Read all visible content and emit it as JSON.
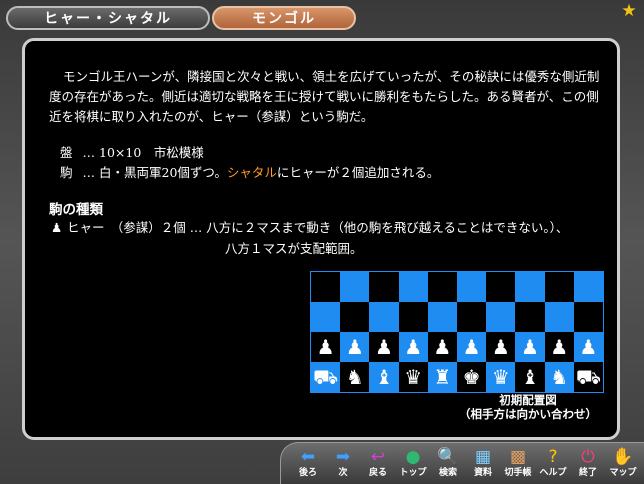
{
  "tabs": {
    "active": "ヒャー・シャタル",
    "inactive": "モンゴル"
  },
  "intro": "モンゴル王ハーンが、隣接国と次々と戦い、領土を広げていったが、その秘訣には優秀な側近制度の存在があった。側近は適切な戦略を王に授けて戦いに勝利をもたらした。ある賢者が、この側近を将棋に取り入れたのが、ヒャー（参謀）という駒だ。",
  "spec": {
    "board_label": "盤",
    "board_value": "…  10×10　市松模様",
    "pieces_label": "駒",
    "pieces_value_a": "…  白・黒両軍20個ずつ。",
    "pieces_value_highlight": "シャタル",
    "pieces_value_b": "にヒャーが２個追加される。"
  },
  "piece_types": {
    "heading": "駒の種類",
    "line1": "ヒャー　（参謀）２個 … 八方に２マスまで動き（他の駒を飛び越えることはできない。）、",
    "line2": "八方１マスが支配範囲。"
  },
  "board": {
    "rows": [
      [
        "",
        "",
        "",
        "",
        "",
        "",
        "",
        "",
        "",
        ""
      ],
      [
        "",
        "",
        "",
        "",
        "",
        "",
        "",
        "",
        "",
        ""
      ],
      [
        "♟",
        "♟",
        "♟",
        "♟",
        "♟",
        "♟",
        "♟",
        "♟",
        "♟",
        "♟"
      ],
      [
        "⛟",
        "♞",
        "♝",
        "♛",
        "♜",
        "♚",
        "♛",
        "♝",
        "♞",
        "⛟"
      ]
    ],
    "caption1": "初期配置図",
    "caption2": "（相手方は向かい合わせ）"
  },
  "toolbar": [
    {
      "name": "back",
      "icon": "⬅",
      "label": "後ろ",
      "color": "#3ea0ff"
    },
    {
      "name": "next",
      "icon": "➡",
      "label": "次",
      "color": "#3ea0ff"
    },
    {
      "name": "return",
      "icon": "↩",
      "label": "戻る",
      "color": "#d040d0"
    },
    {
      "name": "top",
      "icon": "●",
      "label": "トップ",
      "color": "#2eb872"
    },
    {
      "name": "search",
      "icon": "🔍",
      "label": "検索",
      "color": "#cccccc"
    },
    {
      "name": "material",
      "icon": "▦",
      "label": "資料",
      "color": "#7fd0ff"
    },
    {
      "name": "kifu",
      "icon": "▩",
      "label": "切手帳",
      "color": "#e0a060"
    },
    {
      "name": "help",
      "icon": "?",
      "label": "ヘルプ",
      "color": "#ffc400"
    },
    {
      "name": "quit",
      "icon": "⏻",
      "label": "終了",
      "color": "#ff3c7e"
    },
    {
      "name": "map",
      "icon": "✋",
      "label": "マップ",
      "color": "#ffb000"
    }
  ]
}
